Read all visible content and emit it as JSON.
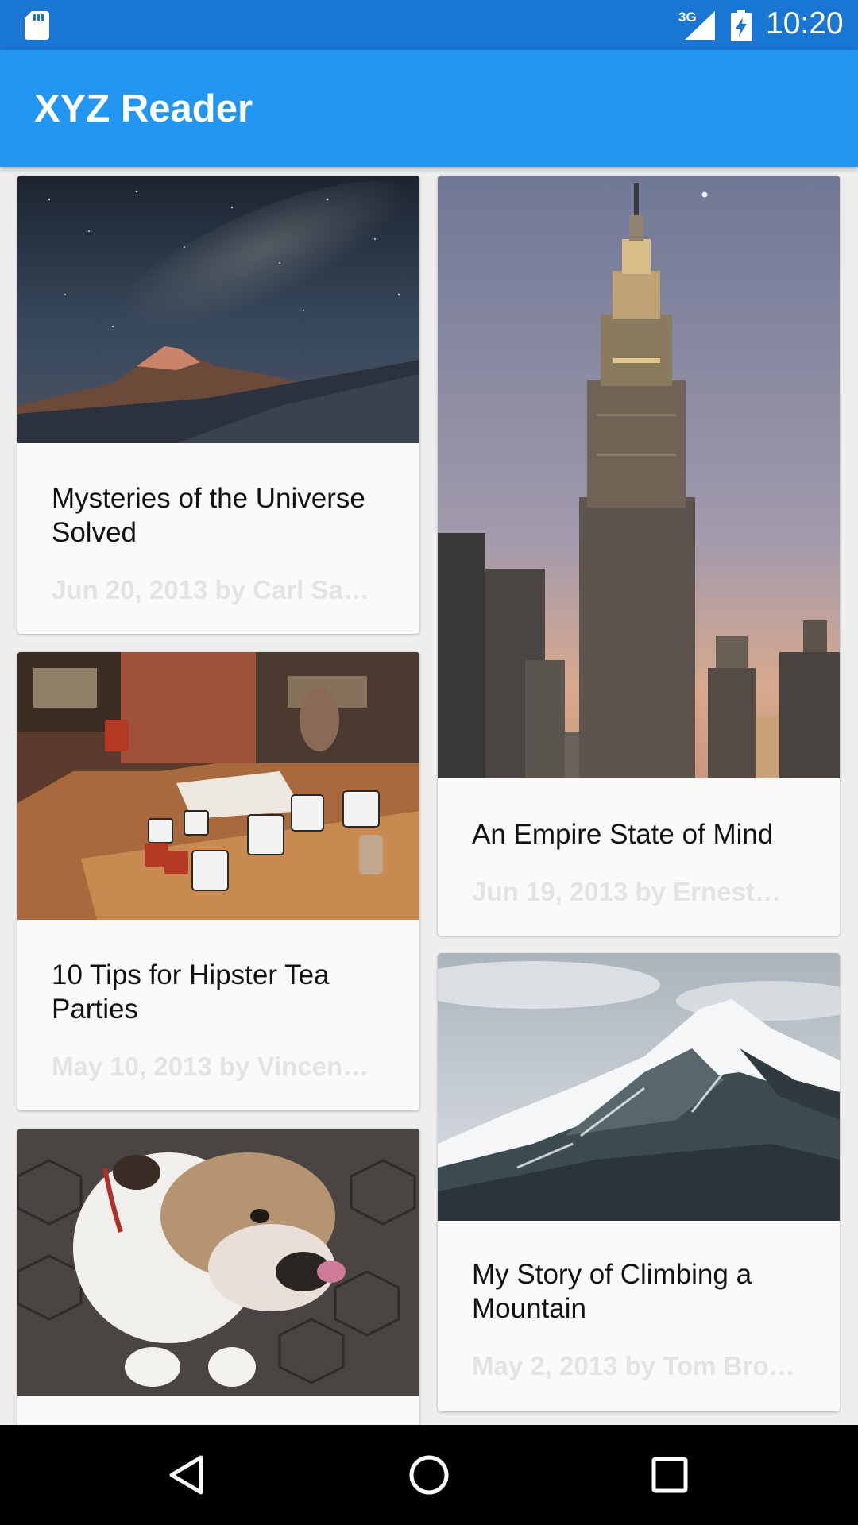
{
  "status_bar": {
    "network": "3G",
    "time": "10:20",
    "icons": [
      "sd-card-icon",
      "signal-icon",
      "battery-charging-icon"
    ]
  },
  "app_bar": {
    "title": "XYZ Reader"
  },
  "articles": [
    {
      "title": "Mysteries of the Universe Solved",
      "meta": "Jun 20, 2013 by Carl Sa…",
      "image": "night-sky-mountains"
    },
    {
      "title": "An Empire State of Mind",
      "meta": "Jun 19, 2013 by Ernest…",
      "image": "empire-state-building"
    },
    {
      "title": "10 Tips for Hipster Tea Parties",
      "meta": "May 10, 2013 by Vincen…",
      "image": "tea-cups-table"
    },
    {
      "title": "My Story of Climbing a Mountain",
      "meta": "May 2, 2013 by Tom Bro…",
      "image": "snowy-mountain"
    },
    {
      "title": "",
      "meta": "",
      "image": "bulldog"
    }
  ],
  "nav_bar": {
    "icons": [
      "back-icon",
      "home-icon",
      "recents-icon"
    ]
  },
  "colors": {
    "status_bar": "#1976d2",
    "app_bar": "#2196f3",
    "background": "#eeeeee",
    "card": "#fafafa",
    "meta_text": "#e3e3e3"
  }
}
